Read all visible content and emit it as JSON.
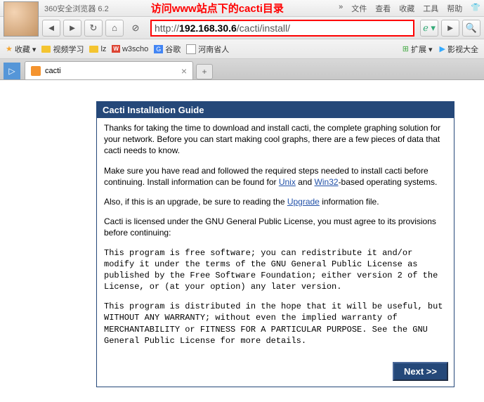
{
  "titlebar": {
    "browser_name": "360安全浏览器 6.2",
    "annotation": "访问www站点下的cacti目录",
    "menu": {
      "file": "文件",
      "view": "查看",
      "fav": "收藏",
      "tools": "工具",
      "help": "帮助"
    }
  },
  "nav": {
    "url_prefix": "http://",
    "url_domain": "192.168.30.6",
    "url_path": "/cacti/install/"
  },
  "favbar": {
    "favorites": "收藏 ▾",
    "items": [
      {
        "label": "视频学习",
        "type": "folder"
      },
      {
        "label": "lz",
        "type": "folder"
      },
      {
        "label": "w3scho",
        "type": "w3"
      },
      {
        "label": "谷歌",
        "type": "g"
      },
      {
        "label": "河南省人",
        "type": "page"
      }
    ],
    "right": {
      "ext": "扩展 ▾",
      "video": "影视大全"
    }
  },
  "tab": {
    "title": "cacti"
  },
  "install": {
    "header": "Cacti Installation Guide",
    "p1": "Thanks for taking the time to download and install cacti, the complete graphing solution for your network. Before you can start making cool graphs, there are a few pieces of data that cacti needs to know.",
    "p2a": "Make sure you have read and followed the required steps needed to install cacti before continuing. Install information can be found for ",
    "unix": "Unix",
    "p2b": " and ",
    "win32": "Win32",
    "p2c": "-based operating systems.",
    "p3a": "Also, if this is an upgrade, be sure to reading the ",
    "upgrade": "Upgrade",
    "p3b": " information file.",
    "p4": "Cacti is licensed under the GNU General Public License, you must agree to its provisions before continuing:",
    "pre1": "This program is free software; you can redistribute it and/or modify it under the terms of the GNU General Public License as published by the Free Software Foundation; either version 2 of the License, or (at your option) any later version.",
    "pre2": "This program is distributed in the hope that it will be useful, but WITHOUT ANY WARRANTY; without even the implied warranty of MERCHANTABILITY or FITNESS FOR A PARTICULAR PURPOSE. See the GNU General Public License for more details.",
    "next": "Next >>"
  }
}
